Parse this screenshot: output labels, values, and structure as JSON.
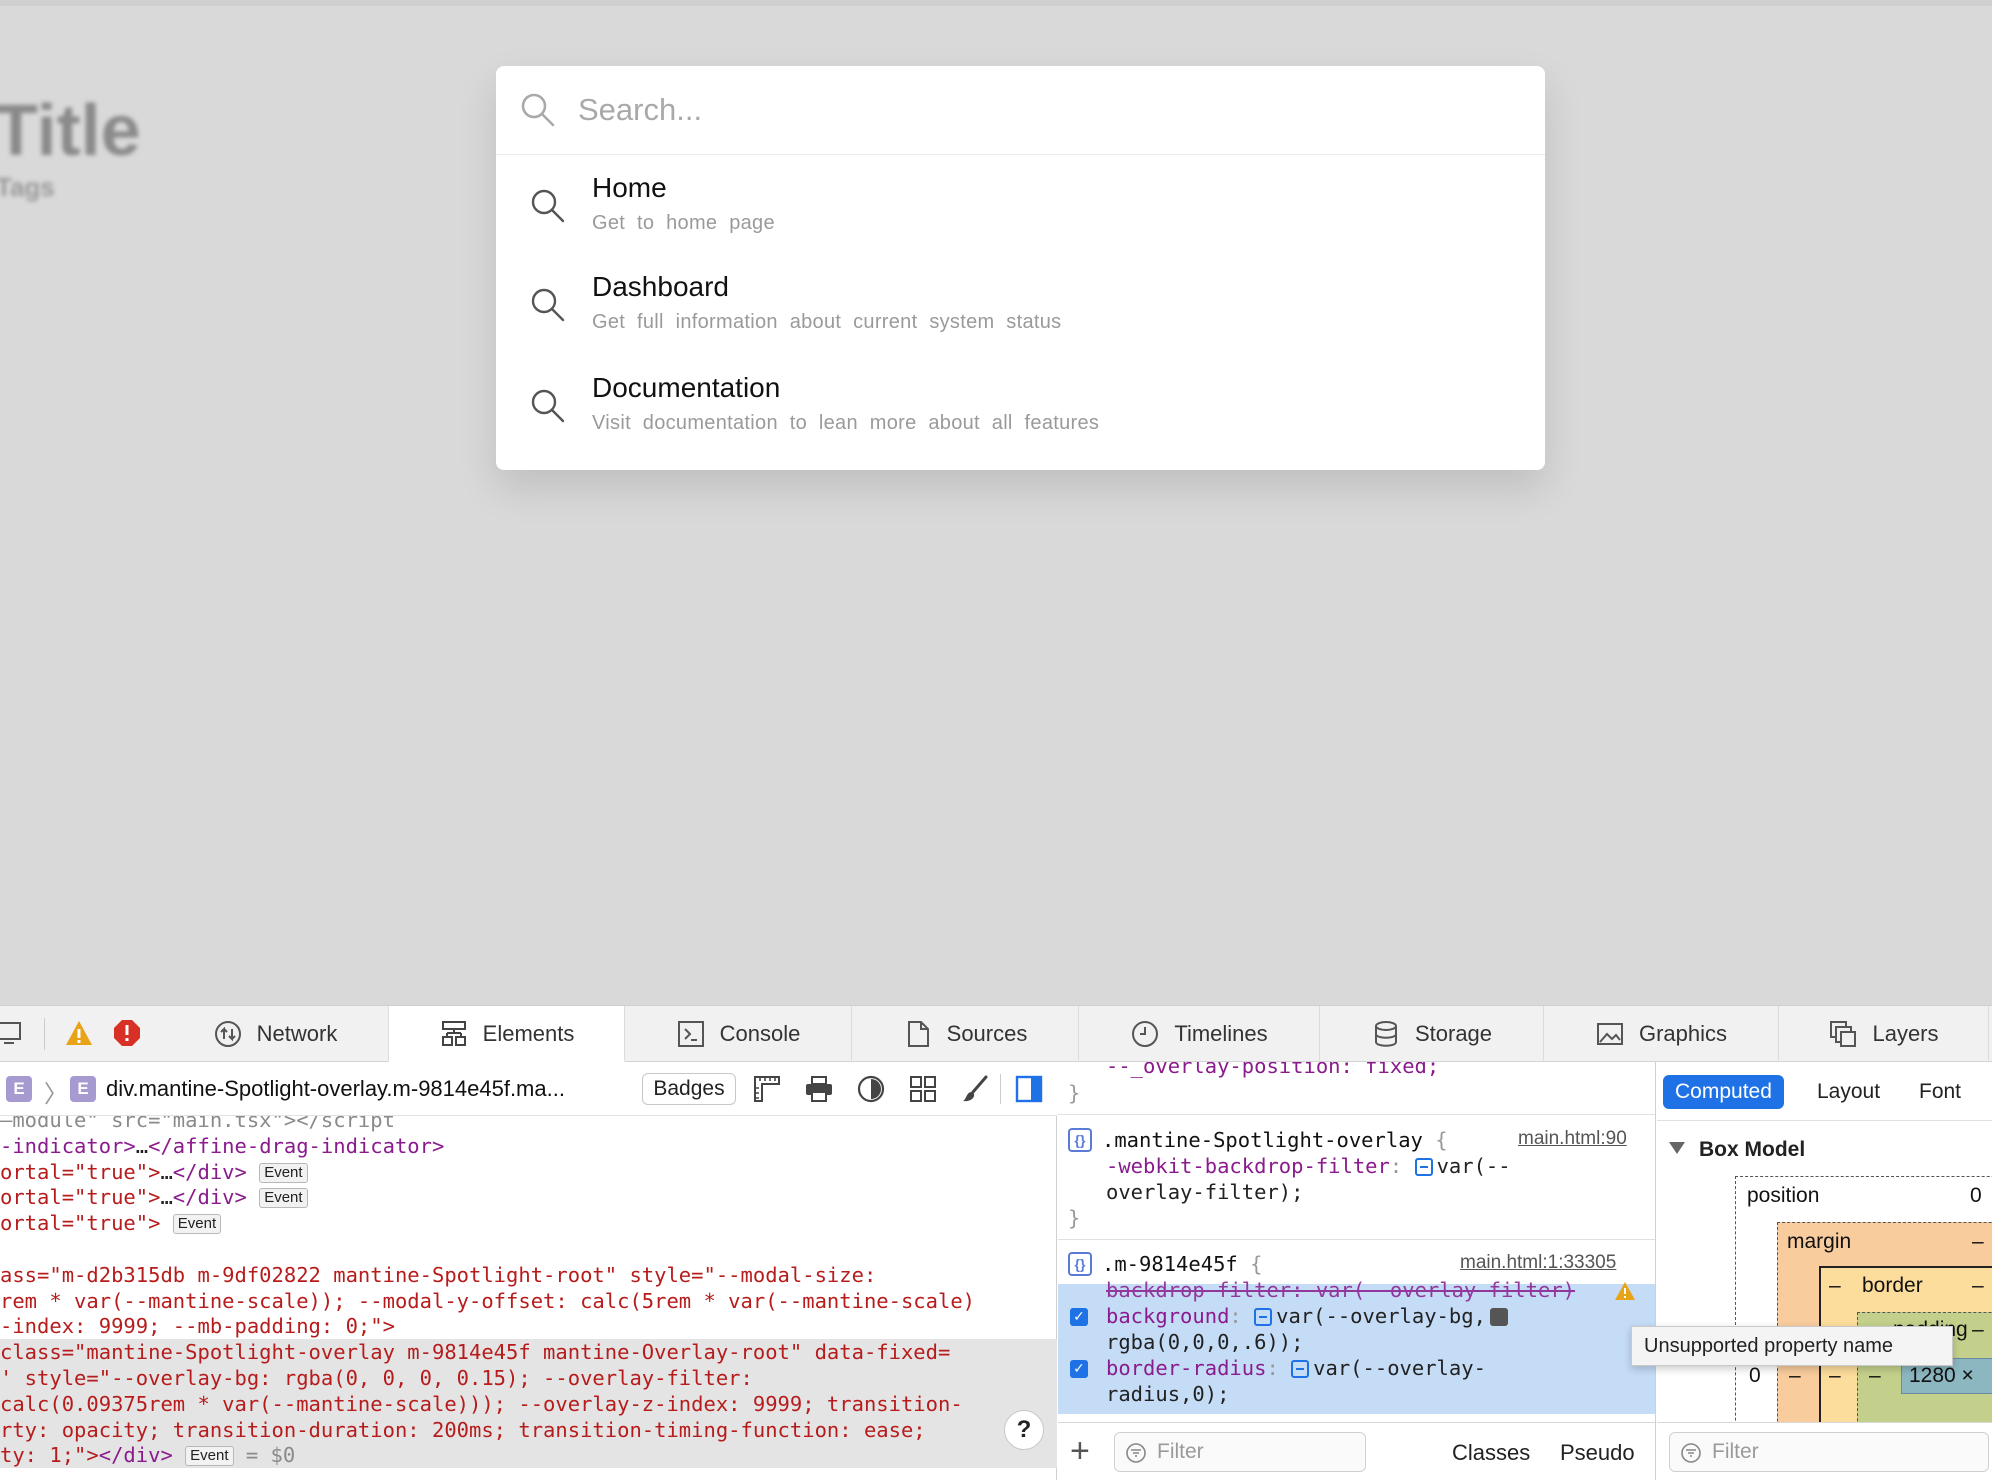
{
  "background": {
    "title": "Title",
    "tags": "Tags"
  },
  "spotlight": {
    "search_placeholder": "Search...",
    "actions": [
      {
        "title": "Home",
        "description": "Get to home page"
      },
      {
        "title": "Dashboard",
        "description": "Get full information about current system status"
      },
      {
        "title": "Documentation",
        "description": "Visit documentation to lean more about all features"
      }
    ]
  },
  "devtools": {
    "tabs": [
      "Network",
      "Elements",
      "Console",
      "Sources",
      "Timelines",
      "Storage",
      "Graphics",
      "Layers"
    ],
    "active_tab": "Elements",
    "breadcrumb": "div.mantine-Spotlight-overlay.m-9814e45f.ma...",
    "breadcrumb_badges": [
      "E",
      "E"
    ],
    "badges_label": "Badges",
    "event_badge": "Event",
    "help_label": "?",
    "dom_lines": [
      {
        "a": "—module\" src=\"main.tsx\"></script",
        "t": "dim"
      },
      {
        "a": "-indicator>",
        "b": "…",
        "c": "</affine-drag-indicator>",
        "t": "tag"
      },
      {
        "a": "ortal=\"true\">",
        "b": "…",
        "c": "</div>",
        "ev": true,
        "t": "attr"
      },
      {
        "a": "ortal=\"true\">",
        "b": "…",
        "c": "</div>",
        "ev": true,
        "t": "attr"
      },
      {
        "a": "ortal=\"true\">",
        "ev": true,
        "t": "attr"
      },
      {
        "a": "",
        "t": "blank"
      },
      {
        "a": "ass=\"m-d2b315db m-9df02822 mantine-Spotlight-root\" style=\"--modal-size:",
        "t": "attr"
      },
      {
        "a": "rem * var(--mantine-scale)); --modal-y-offset: calc(5rem * var(--mantine-scale)",
        "t": "attr"
      },
      {
        "a": "-index: 9999; --mb-padding: 0;\">",
        "t": "attr"
      },
      {
        "a": "class=\"mantine-Spotlight-overlay m-9814e45f mantine-Overlay-root\" data-fixed=",
        "t": "attr"
      },
      {
        "a": "' style=\"--overlay-bg: rgba(0, 0, 0, 0.15); --overlay-filter:",
        "t": "attr"
      },
      {
        "a": "calc(0.09375rem * var(--mantine-scale))); --overlay-z-index: 9999; transition-",
        "t": "attr"
      },
      {
        "a": "rty: opacity; transition-duration: 200ms; transition-timing-function: ease;",
        "t": "attr"
      },
      {
        "a": "ty: 1;\">",
        "c": "</div>",
        "ev": true,
        "d": " = $0",
        "t": "attr"
      }
    ],
    "styles": {
      "top_fragment": "--_overlay-position: fixed;",
      "rule1": {
        "selector": ".mantine-Spotlight-overlay",
        "source": "main.html:90",
        "prop": "-webkit-backdrop-filter",
        "val1": "var(--",
        "val2": "overlay-filter);"
      },
      "rule2": {
        "selector": ".m-9814e45f",
        "source": "main.html:1:33305",
        "prop1": "backdrop-filter",
        "val1": "var(--overlay-filter)",
        "prop2": "background",
        "val2a": "var(--overlay-bg,",
        "val2b": "rgba(0,0,0,.6));",
        "prop3": "border-radius",
        "val3a": "var(--overlay-",
        "val3b": "radius,0);"
      },
      "footer": {
        "filter_placeholder": "Filter",
        "classes_label": "Classes",
        "pseudo_label": "Pseudo"
      }
    },
    "computed": {
      "tabs": [
        "Computed",
        "Layout",
        "Font"
      ],
      "active": "Computed",
      "box_model_label": "Box Model",
      "position_label": "position",
      "position_value": "0",
      "margin_label": "margin",
      "border_label": "border",
      "padding_label": "padding",
      "dash": "–",
      "left_value": "0",
      "width_value": "1280 ×",
      "filter_placeholder": "Filter",
      "tooltip": "Unsupported property name"
    },
    "colors": {
      "accent": "#1f72e6",
      "tag": "#8a1b8d",
      "attr": "#b71c1c",
      "warning": "#e8a317",
      "error": "#d93025"
    }
  }
}
